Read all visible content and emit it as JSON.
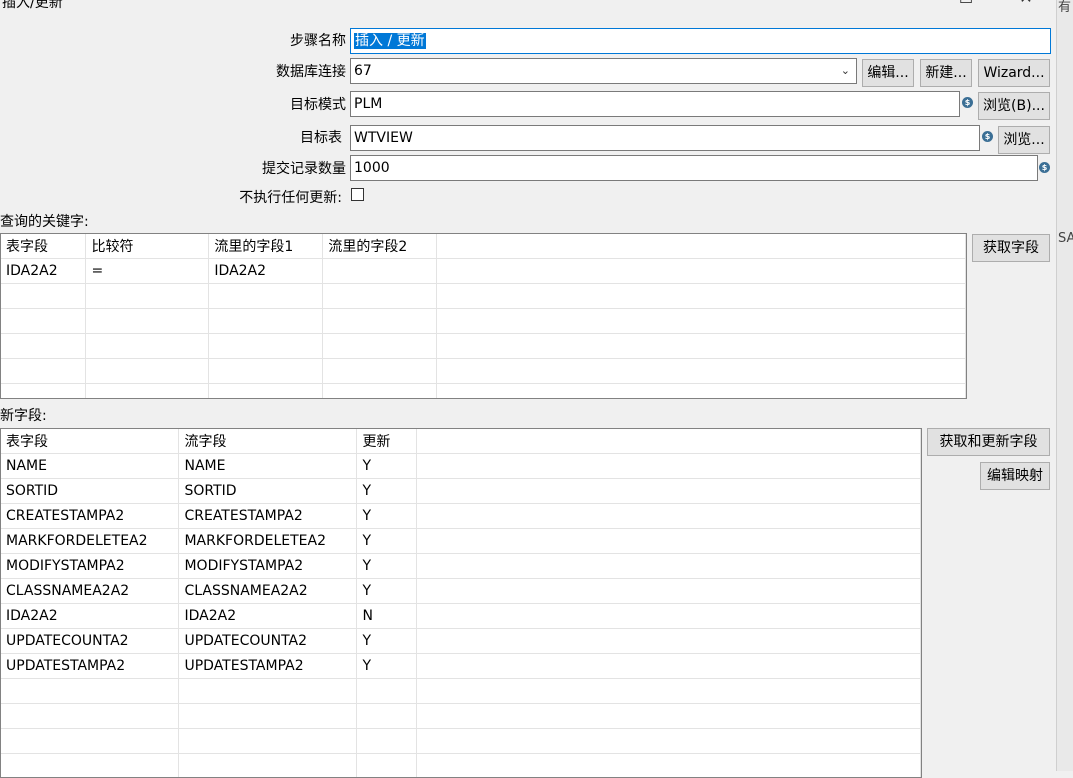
{
  "window": {
    "title": "插入/更新",
    "maximize_glyph": "☐",
    "close_glyph": "✕"
  },
  "right_strip": {
    "text_top": "有",
    "text_mid": "SA"
  },
  "form": {
    "step_name_label": "步骤名称",
    "step_name_value": "插入 / 更新",
    "db_conn_label": "数据库连接",
    "db_conn_value": "67",
    "edit_button": "编辑...",
    "new_button": "新建...",
    "wizard_button": "Wizard...",
    "schema_label": "目标模式",
    "schema_value": "PLM",
    "browse_b_button": "浏览(B)...",
    "table_label": "目标表",
    "table_value": "WTVIEW",
    "browse_button": "浏览...",
    "commit_label": "提交记录数量",
    "commit_value": "1000",
    "no_update_label": "不执行任何更新:"
  },
  "keys": {
    "label": "表查询的关键字:",
    "get_fields_button": "获取字段",
    "headers": [
      "表字段",
      "比较符",
      "流里的字段1",
      "流里的字段2"
    ],
    "rows": [
      [
        "IDA2A2",
        "=",
        "IDA2A2",
        ""
      ]
    ]
  },
  "update": {
    "label": "更新字段:",
    "get_update_button": "获取和更新字段",
    "edit_mapping_button": "编辑映射",
    "headers": [
      "表字段",
      "流字段",
      "更新"
    ],
    "rows": [
      [
        "NAME",
        "NAME",
        "Y"
      ],
      [
        "SORTID",
        "SORTID",
        "Y"
      ],
      [
        "CREATESTAMPA2",
        "CREATESTAMPA2",
        "Y"
      ],
      [
        "MARKFORDELETEA2",
        "MARKFORDELETEA2",
        "Y"
      ],
      [
        "MODIFYSTAMPA2",
        "MODIFYSTAMPA2",
        "Y"
      ],
      [
        "CLASSNAMEA2A2",
        "CLASSNAMEA2A2",
        "Y"
      ],
      [
        "IDA2A2",
        "IDA2A2",
        "N"
      ],
      [
        "UPDATECOUNTA2",
        "UPDATECOUNTA2",
        "Y"
      ],
      [
        "UPDATESTAMPA2",
        "UPDATESTAMPA2",
        "Y"
      ]
    ]
  }
}
